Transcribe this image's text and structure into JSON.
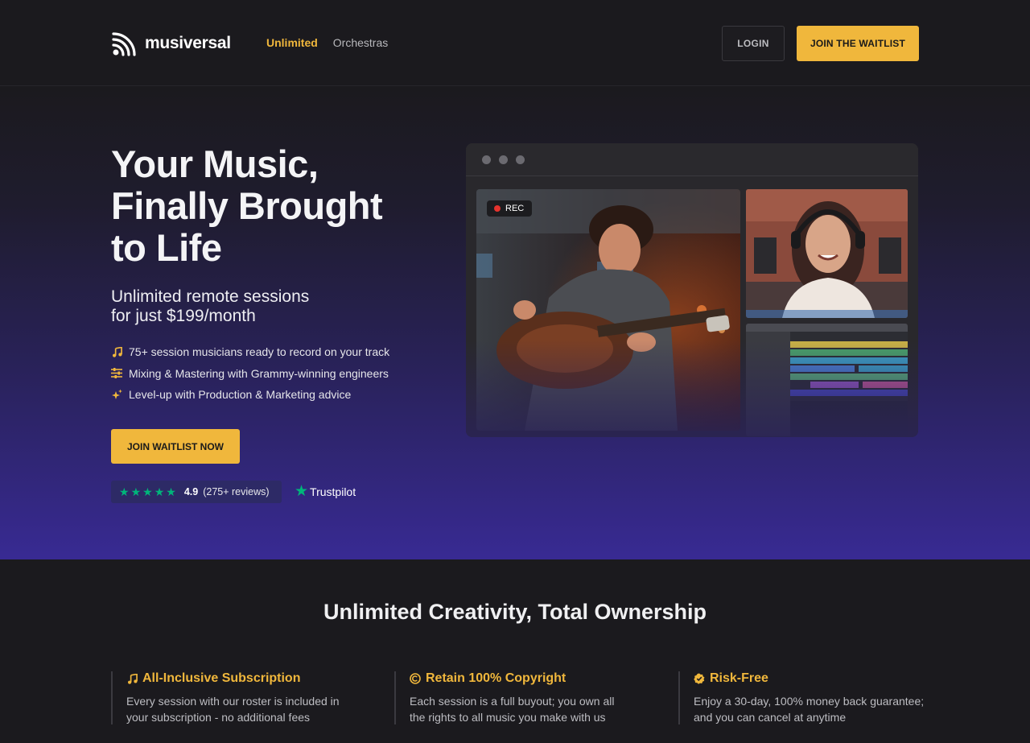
{
  "brand": {
    "name": "musiversal"
  },
  "nav": {
    "links": [
      "Unlimited",
      "Orchestras"
    ],
    "active": "Unlimited"
  },
  "header": {
    "login_label": "LOGIN",
    "waitlist_label": "JOIN THE WAITLIST"
  },
  "hero": {
    "title_lines": [
      "Your Music,",
      "Finally Brought",
      "to Life"
    ],
    "subtitle_lines": [
      "Unlimited remote sessions",
      "for just $199/month"
    ],
    "features": [
      {
        "icon": "music-note-icon",
        "text": "75+ session musicians ready to record on your track"
      },
      {
        "icon": "sliders-icon",
        "text": "Mixing & Mastering with Grammy-winning engineers"
      },
      {
        "icon": "sparkle-icon",
        "text": "Level-up with Production & Marketing advice"
      }
    ],
    "cta_label": "JOIN WAITLIST NOW",
    "rating": {
      "stars": 5,
      "score": "4.9",
      "count": "(275+ reviews)"
    },
    "trustpilot_label": "Trustpilot",
    "rec_label": "REC"
  },
  "section": {
    "title": "Unlimited Creativity, Total Ownership",
    "columns": [
      {
        "icon": "music-note-icon",
        "title": "All-Inclusive Subscription",
        "text_lines": [
          "Every session with our roster is included in",
          "your subscription - no additional fees"
        ]
      },
      {
        "icon": "copyright-icon",
        "title": "Retain 100% Copyright",
        "text_lines": [
          "Each session is a full buyout; you own all",
          "the rights to all music you make with us"
        ]
      },
      {
        "icon": "badge-check-icon",
        "title": "Risk-Free",
        "text_lines": [
          "Enjoy a 30-day, 100% money back guarantee;",
          "and you can cancel at anytime"
        ]
      }
    ]
  },
  "colors": {
    "accent": "#f0b73c",
    "background": "#1b1a1e",
    "hero_bottom": "#382a93",
    "trustpilot": "#00b67a"
  }
}
